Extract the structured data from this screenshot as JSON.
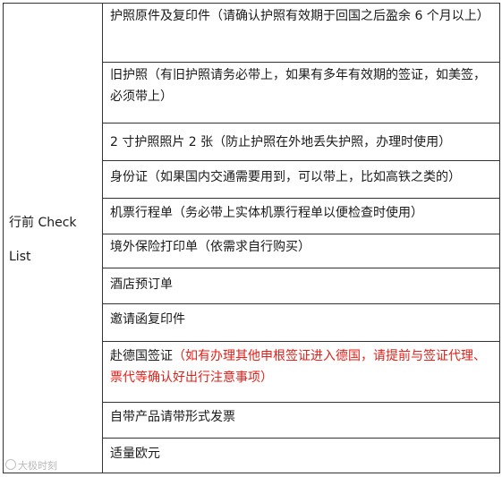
{
  "table": {
    "left_label": "行前 Check List",
    "rows": [
      {
        "text": "护照原件及复印件（请确认护照有效期于回国之后盈余 6 个月以上）"
      },
      {
        "text": "旧护照（有旧护照请务必带上，如果有多年有效期的签证，如美签，必须带上）"
      },
      {
        "text": "2 寸护照照片 2 张（防止护照在外地丢失护照，办理时使用）"
      },
      {
        "text": "身份证（如果国内交通需要用到，可以带上，比如高铁之类的）"
      },
      {
        "text": "机票行程单（务必带上实体机票行程单以便检查时使用）"
      },
      {
        "text": "境外保险打印单（依需求自行购买）"
      },
      {
        "text": "酒店预订单"
      },
      {
        "text": "邀请函复印件"
      },
      {
        "text": "赴德国签证",
        "note": "（如有办理其他申根签证进入德国，请提前与签证代理、票代等确认好出行注意事项）",
        "note_color": "#e0201b"
      },
      {
        "text": "自带产品请带形式发票"
      },
      {
        "text": "适量欧元"
      }
    ]
  },
  "watermark": {
    "text": "大极时刻"
  }
}
